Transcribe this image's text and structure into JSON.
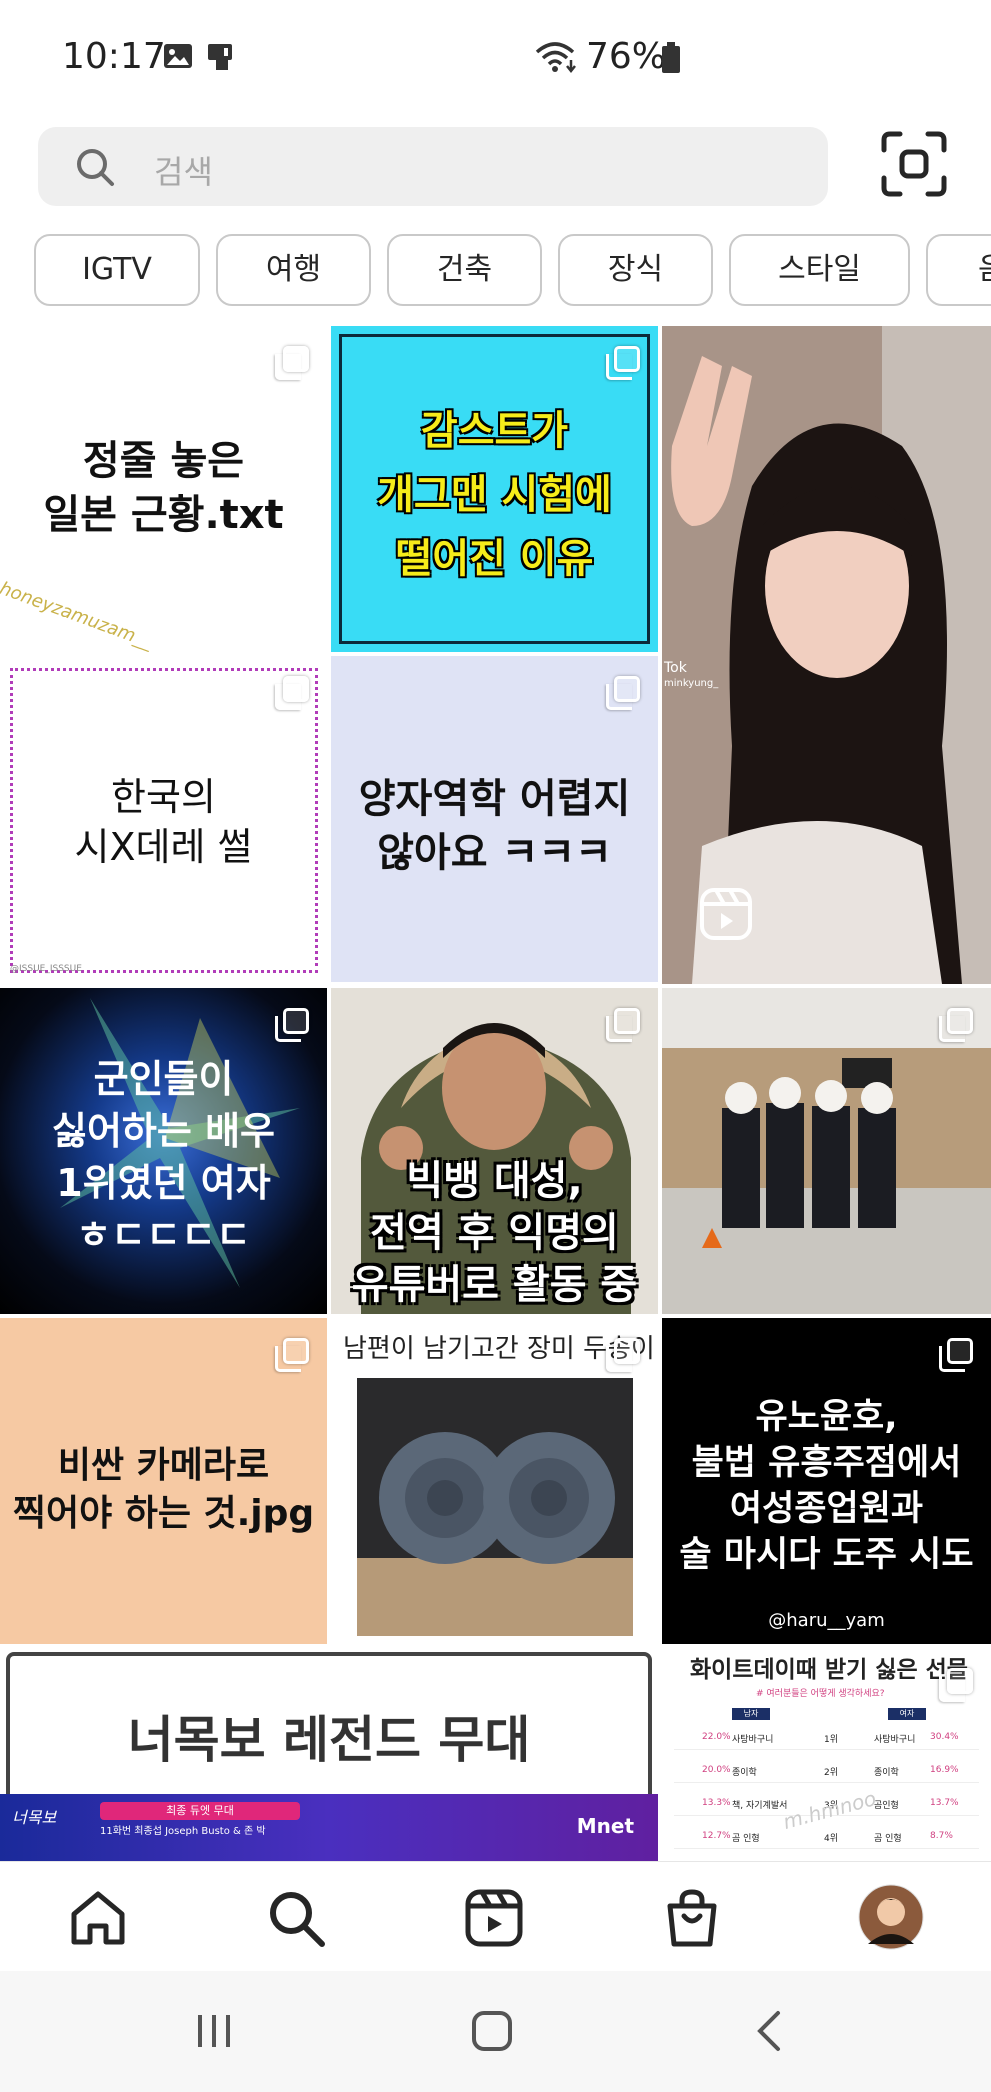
{
  "status_bar": {
    "time": "10:17",
    "battery": "76%",
    "icons": [
      "image-icon",
      "device-icon",
      "wifi-icon",
      "battery-icon"
    ]
  },
  "search": {
    "placeholder": "검색"
  },
  "chips": [
    "IGTV",
    "여행",
    "건축",
    "장식",
    "스타일",
    "음"
  ],
  "tiles": {
    "t1": {
      "line1": "정줄 놓은",
      "line2": "일본 근황.txt",
      "watermark": "honeyzamuzam__"
    },
    "t2": {
      "line1": "감스트가",
      "line2": "개그맨 시험에",
      "line3": "떨어진 이유"
    },
    "t3": {
      "brand": "Tok",
      "user": "minkyung_"
    },
    "t4": {
      "line1": "한국의",
      "line2": "시X데레 썰",
      "watermark": "@ISSUE_ISSSUE"
    },
    "t5": {
      "line1": "양자역학 어렵지",
      "line2": "않아요 ㅋㅋㅋ"
    },
    "t7": {
      "line1": "군인들이",
      "line2": "싫어하는 배우",
      "line3": "1위였던 여자",
      "line4": "ㅎㄷㄷㄷㄷ"
    },
    "t8": {
      "line1": "빅뱅 대성,",
      "line2": "전역 후 익명의",
      "line3": "유튜버로 활동 중"
    },
    "t10": {
      "line1": "비싼 카메라로",
      "line2": "찍어야 하는 것.jpg"
    },
    "t11": {
      "title": "남편이 남기고간 장미 두송이"
    },
    "t12": {
      "line1": "유노윤호,",
      "line2": "불법 유흥주점에서",
      "line3": "여성종업원과",
      "line4": "술 마시다 도주 시도",
      "handle": "@haru__yam"
    },
    "t13": {
      "title": "너목보 레전드 무대",
      "logo": "너목보",
      "caption": "최종 듀엣 무대",
      "subcaption": "11화번 최종섭 Joseph Busto & 존 박",
      "channel": "Mnet"
    },
    "t14": {
      "title": "화이트데이때 받기 싫은 선물",
      "subtitle": "# 여러분들은 어떻게 생각하세요?",
      "col_left": "남자",
      "col_right": "여자",
      "rows": [
        {
          "lp": "22.0%",
          "li": "사탕바구니",
          "rank": "1위",
          "ri": "사탕바구니",
          "rp": "30.4%"
        },
        {
          "lp": "20.0%",
          "li": "종이학",
          "rank": "2위",
          "ri": "종이학",
          "rp": "16.9%"
        },
        {
          "lp": "13.3%",
          "li": "책, 자기계발서",
          "rank": "3위",
          "ri": "곰인형",
          "rp": "13.7%"
        },
        {
          "lp": "12.7%",
          "li": "곰 인형",
          "rank": "4위",
          "ri": "곰 인형",
          "rp": "8.7%"
        }
      ],
      "watermark": "m.hmnoo"
    }
  },
  "bottom_nav": [
    "home-icon",
    "search-icon",
    "reels-icon",
    "shop-icon",
    "profile-avatar"
  ],
  "colors": {
    "accent": "#262626",
    "chip_border": "#c9c9c9",
    "search_bg": "#efefef",
    "cyan": "#39dcf5",
    "peach": "#f6c9a3",
    "lavender": "#dfe3f5"
  }
}
